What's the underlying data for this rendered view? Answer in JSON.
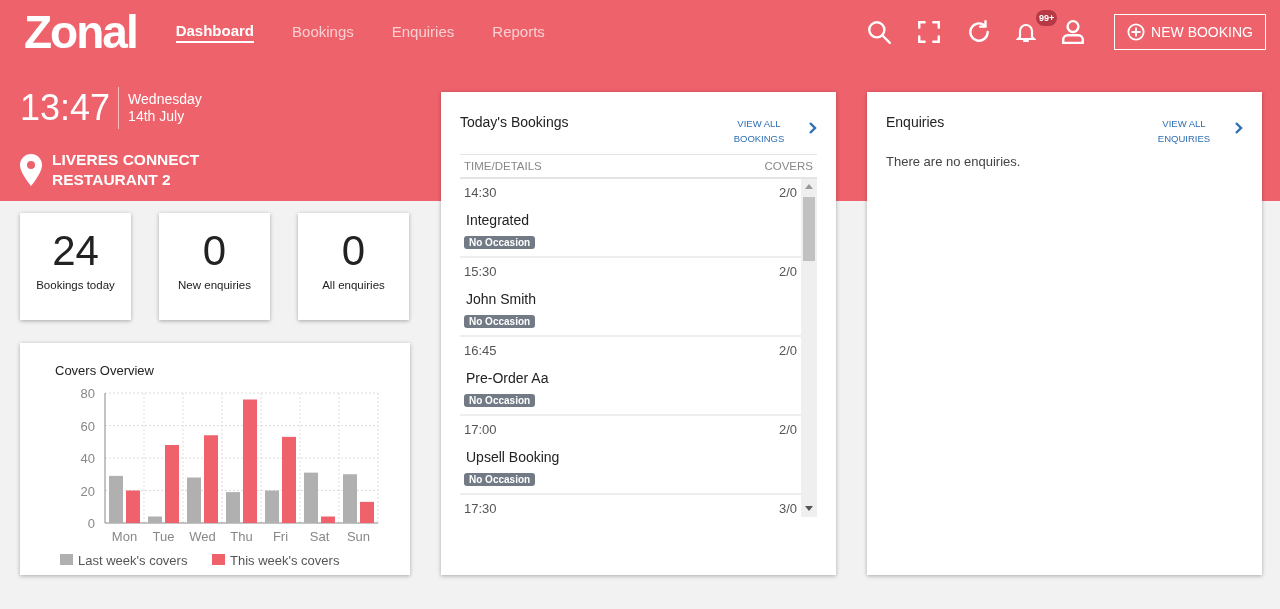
{
  "brand": {
    "logo": "Zonal"
  },
  "nav": [
    {
      "label": "Dashboard",
      "selected": true
    },
    {
      "label": "Bookings",
      "selected": false
    },
    {
      "label": "Enquiries",
      "selected": false
    },
    {
      "label": "Reports",
      "selected": false
    }
  ],
  "notifications": {
    "badge": "99+"
  },
  "new_booking_button": "NEW BOOKING",
  "clock": {
    "time": "13:47",
    "day": "Wednesday",
    "date": "14th July"
  },
  "location": {
    "name": "LIVERES CONNECT RESTAURANT 2"
  },
  "stats": [
    {
      "value": "24",
      "label": "Bookings today"
    },
    {
      "value": "0",
      "label": "New enquiries"
    },
    {
      "value": "0",
      "label": "All enquiries"
    }
  ],
  "covers_overview": {
    "title": "Covers Overview",
    "chart_data": {
      "type": "bar",
      "categories": [
        "Mon",
        "Tue",
        "Wed",
        "Thu",
        "Fri",
        "Sat",
        "Sun"
      ],
      "ylim": [
        0,
        80
      ],
      "grid": true,
      "legend": true,
      "yticks": [
        0,
        20,
        40,
        60,
        80
      ],
      "series": [
        {
          "name": "Last week's covers",
          "color": "#b0b0b0",
          "values": [
            29,
            4,
            28,
            19,
            20,
            31,
            30
          ]
        },
        {
          "name": "This week's covers",
          "color": "#ef626c",
          "values": [
            20,
            48,
            54,
            76,
            53,
            4,
            13
          ]
        }
      ]
    }
  },
  "todays_bookings": {
    "title": "Today's Bookings",
    "view_all": "VIEW ALL BOOKINGS",
    "columns": [
      "TIME/DETAILS",
      "COVERS"
    ],
    "rows": [
      {
        "time": "14:30",
        "covers": "2/0",
        "name": "Integrated",
        "occasion": "No Occasion"
      },
      {
        "time": "15:30",
        "covers": "2/0",
        "name": "John Smith",
        "occasion": "No Occasion"
      },
      {
        "time": "16:45",
        "covers": "2/0",
        "name": "Pre-Order Aa",
        "occasion": "No Occasion"
      },
      {
        "time": "17:00",
        "covers": "2/0",
        "name": "Upsell Booking",
        "occasion": "No Occasion"
      },
      {
        "time": "17:30",
        "covers": "3/0"
      }
    ]
  },
  "enquiries": {
    "title": "Enquiries",
    "view_all": "VIEW ALL ENQUIRIES",
    "empty_message": "There are no enquiries."
  }
}
